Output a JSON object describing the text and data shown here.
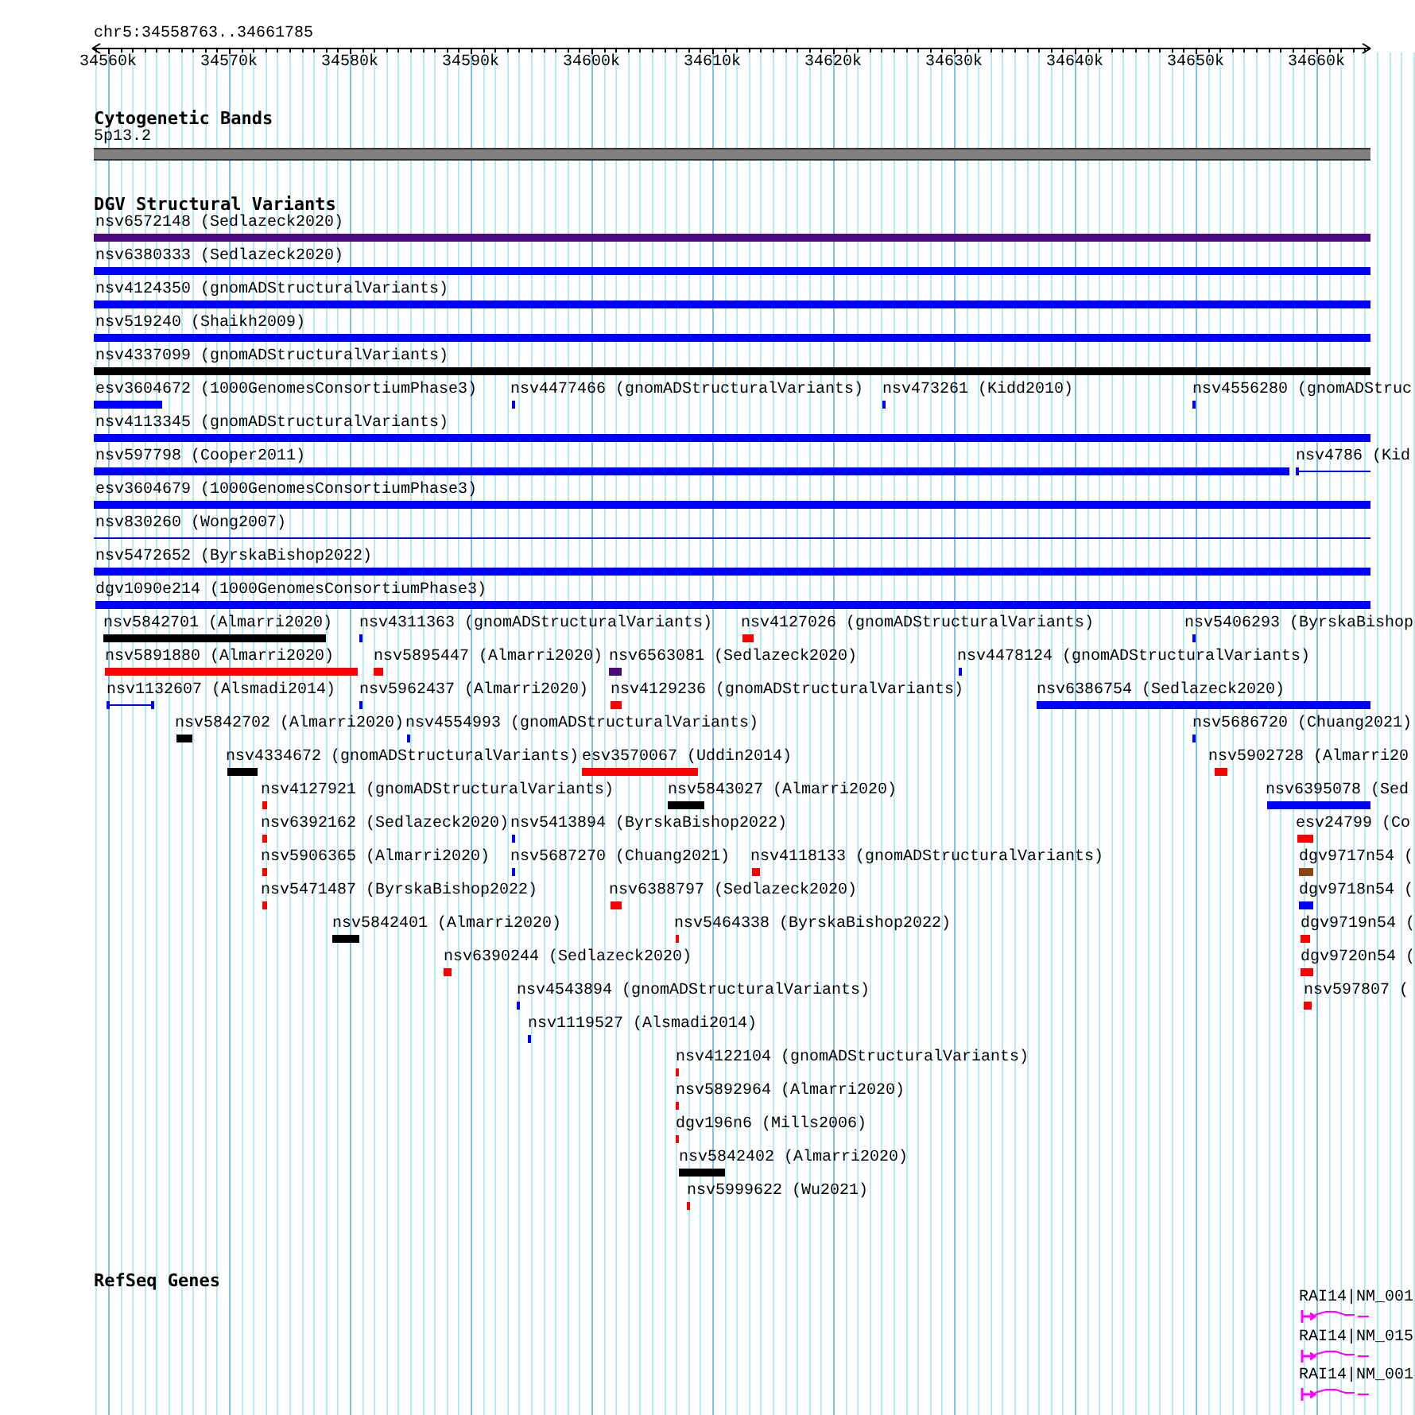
{
  "locus": "chr5:34558763..34661785",
  "ruler": {
    "ticks": [
      "34560k",
      "34570k",
      "34580k",
      "34590k",
      "34600k",
      "34610k",
      "34620k",
      "34630k",
      "34640k",
      "34650k",
      "34660k"
    ]
  },
  "tracks": [
    {
      "title": "Cytogenetic Bands",
      "kind": "bands",
      "features": [
        {
          "label": "5p13.2",
          "color": "#808080"
        }
      ]
    },
    {
      "title": "DGV Structural Variants",
      "kind": "variants",
      "rows": [
        [
          {
            "label": "nsv6572148 (Sedlazeck2020)",
            "color": "#4b0a80",
            "kind": "bar"
          }
        ],
        [
          {
            "label": "nsv6380333 (Sedlazeck2020)",
            "color": "#0000ff",
            "kind": "bar"
          }
        ],
        [
          {
            "label": "nsv4124350 (gnomADStructuralVariants)",
            "color": "#0000ff",
            "kind": "bar"
          }
        ],
        [
          {
            "label": "nsv519240 (Shaikh2009)",
            "color": "#0000ff",
            "kind": "bar"
          }
        ],
        [
          {
            "label": "nsv4337099 (gnomADStructuralVariants)",
            "color": "#000000",
            "kind": "bar"
          }
        ],
        [
          {
            "label": "esv3604672 (1000GenomesConsortiumPhase3)",
            "color": "#0000ff",
            "kind": "bar"
          },
          {
            "label": "nsv4477466 (gnomADStructuralVariants)",
            "color": "#0000ff",
            "kind": "bar"
          },
          {
            "label": "nsv473261 (Kidd2010)",
            "color": "#0000ff",
            "kind": "bar"
          },
          {
            "label": "nsv4556280 (gnomADStruc",
            "color": "#0000ff",
            "kind": "bar"
          }
        ],
        [
          {
            "label": "nsv4113345 (gnomADStructuralVariants)",
            "color": "#0000ff",
            "kind": "bar"
          }
        ],
        [
          {
            "label": "nsv597798 (Cooper2011)",
            "color": "#0000ff",
            "kind": "bar"
          },
          {
            "label": "nsv4786 (Kid",
            "color": "#0000ff",
            "kind": "line"
          }
        ],
        [
          {
            "label": "esv3604679 (1000GenomesConsortiumPhase3)",
            "color": "#0000ff",
            "kind": "bar"
          }
        ],
        [
          {
            "label": "nsv830260 (Wong2007)",
            "color": "#0000ff",
            "kind": "line"
          }
        ],
        [
          {
            "label": "nsv5472652 (ByrskaBishop2022)",
            "color": "#0000ff",
            "kind": "bar"
          }
        ],
        [
          {
            "label": "dgv1090e214 (1000GenomesConsortiumPhase3)",
            "color": "#0000ff",
            "kind": "bar"
          }
        ],
        [
          {
            "label": "nsv5842701 (Almarri2020)",
            "color": "#000000",
            "kind": "bar"
          },
          {
            "label": "nsv4311363 (gnomADStructuralVariants)",
            "color": "#0000ff",
            "kind": "bar"
          },
          {
            "label": "nsv4127026 (gnomADStructuralVariants)",
            "color": "#ff0000",
            "kind": "bar"
          },
          {
            "label": "nsv5406293 (ByrskaBishop",
            "color": "#0000ff",
            "kind": "bar"
          }
        ],
        [
          {
            "label": "nsv5891880 (Almarri2020)",
            "color": "#ff0000",
            "kind": "bar"
          },
          {
            "label": "nsv5895447 (Almarri2020)",
            "color": "#ff0000",
            "kind": "bar"
          },
          {
            "label": "nsv6563081 (Sedlazeck2020)",
            "color": "#4b0a80",
            "kind": "bar"
          },
          {
            "label": "nsv4478124 (gnomADStructuralVariants)",
            "color": "#0000ff",
            "kind": "bar"
          }
        ],
        [
          {
            "label": "nsv1132607 (Alsmadi2014)",
            "color": "#0000ff",
            "kind": "line"
          },
          {
            "label": "nsv5962437 (Almarri2020)",
            "color": "#0000ff",
            "kind": "bar"
          },
          {
            "label": "nsv4129236 (gnomADStructuralVariants)",
            "color": "#ff0000",
            "kind": "bar"
          },
          {
            "label": "nsv6386754 (Sedlazeck2020)",
            "color": "#0000ff",
            "kind": "bar"
          }
        ],
        [
          {
            "label": "nsv5842702 (Almarri2020)",
            "color": "#000000",
            "kind": "bar"
          },
          {
            "label": "nsv4554993 (gnomADStructuralVariants)",
            "color": "#0000ff",
            "kind": "bar"
          },
          {
            "label": "nsv5686720 (Chuang2021)",
            "color": "#0000ff",
            "kind": "bar"
          }
        ],
        [
          {
            "label": "nsv4334672 (gnomADStructuralVariants)",
            "color": "#000000",
            "kind": "bar"
          },
          {
            "label": "esv3570067 (Uddin2014)",
            "color": "#ff0000",
            "kind": "bar"
          },
          {
            "label": "nsv5902728 (Almarri20",
            "color": "#ff0000",
            "kind": "bar"
          }
        ],
        [
          {
            "label": "nsv4127921 (gnomADStructuralVariants)",
            "color": "#ff0000",
            "kind": "bar"
          },
          {
            "label": "nsv5843027 (Almarri2020)",
            "color": "#000000",
            "kind": "bar"
          },
          {
            "label": "nsv6395078 (Sed",
            "color": "#0000ff",
            "kind": "bar"
          }
        ],
        [
          {
            "label": "nsv6392162 (Sedlazeck2020)",
            "color": "#ff0000",
            "kind": "bar"
          },
          {
            "label": "nsv5413894 (ByrskaBishop2022)",
            "color": "#0000ff",
            "kind": "bar"
          },
          {
            "label": "esv24799 (Co",
            "color": "#ff0000",
            "kind": "bar"
          }
        ],
        [
          {
            "label": "nsv5906365 (Almarri2020)",
            "color": "#ff0000",
            "kind": "bar"
          },
          {
            "label": "nsv5687270 (Chuang2021)",
            "color": "#0000ff",
            "kind": "bar"
          },
          {
            "label": "nsv4118133 (gnomADStructuralVariants)",
            "color": "#ff0000",
            "kind": "bar"
          },
          {
            "label": "dgv9717n54 (",
            "color": "#8b4513",
            "kind": "bar"
          }
        ],
        [
          {
            "label": "nsv5471487 (ByrskaBishop2022)",
            "color": "#ff0000",
            "kind": "bar"
          },
          {
            "label": "nsv6388797 (Sedlazeck2020)",
            "color": "#ff0000",
            "kind": "bar"
          },
          {
            "label": "dgv9718n54 (",
            "color": "#0000ff",
            "kind": "bar"
          }
        ],
        [
          {
            "label": "nsv5842401 (Almarri2020)",
            "color": "#000000",
            "kind": "bar"
          },
          {
            "label": "nsv5464338 (ByrskaBishop2022)",
            "color": "#ff0000",
            "kind": "bar"
          },
          {
            "label": "dgv9719n54 (",
            "color": "#ff0000",
            "kind": "bar"
          }
        ],
        [
          {
            "label": "nsv6390244 (Sedlazeck2020)",
            "color": "#ff0000",
            "kind": "bar"
          },
          {
            "label": "dgv9720n54 (",
            "color": "#ff0000",
            "kind": "bar"
          }
        ],
        [
          {
            "label": "nsv4543894 (gnomADStructuralVariants)",
            "color": "#0000ff",
            "kind": "bar"
          },
          {
            "label": "nsv597807 (",
            "color": "#ff0000",
            "kind": "bar"
          }
        ],
        [
          {
            "label": "nsv1119527 (Alsmadi2014)",
            "color": "#0000ff",
            "kind": "bar"
          }
        ],
        [
          {
            "label": "nsv4122104 (gnomADStructuralVariants)",
            "color": "#ff0000",
            "kind": "bar"
          }
        ],
        [
          {
            "label": "nsv5892964 (Almarri2020)",
            "color": "#ff0000",
            "kind": "bar"
          }
        ],
        [
          {
            "label": "dgv196n6 (Mills2006)",
            "color": "#ff0000",
            "kind": "bar"
          }
        ],
        [
          {
            "label": "nsv5842402 (Almarri2020)",
            "color": "#000000",
            "kind": "bar"
          }
        ],
        [
          {
            "label": "nsv5999622 (Wu2021)",
            "color": "#ff0000",
            "kind": "bar"
          }
        ]
      ]
    },
    {
      "title": "RefSeq Genes",
      "kind": "genes",
      "features": [
        {
          "label": "RAI14|NM_001",
          "color": "#ff00ff"
        },
        {
          "label": "RAI14|NM_015",
          "color": "#ff00ff"
        },
        {
          "label": "RAI14|NM_001",
          "color": "#ff00ff"
        }
      ]
    }
  ]
}
